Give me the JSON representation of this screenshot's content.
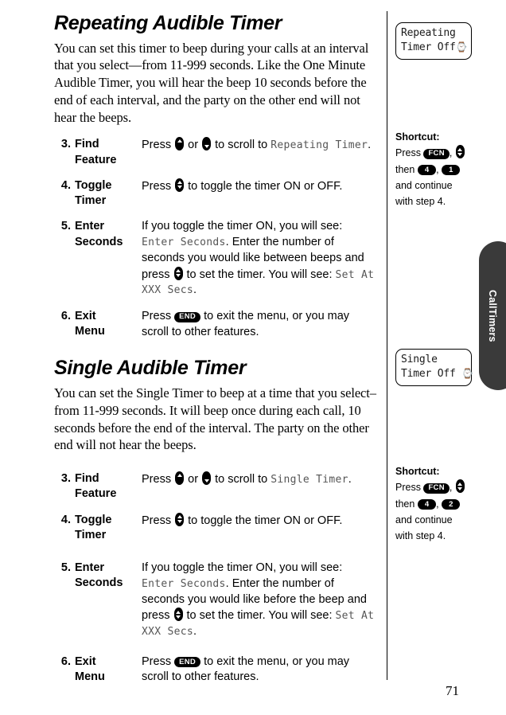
{
  "page": {
    "number": "71",
    "thumb_tab_label": "CallTimers",
    "tab_color": "#3a3a3a"
  },
  "sections": [
    {
      "title": "Repeating Audible Timer",
      "intro": "You can set this timer to beep during your calls at an interval that you select—from 11-999 seconds. Like the One Minute Audible Timer, you will hear the beep 10 seconds before the end of each interval, and the party on the other end will not hear the beeps.",
      "lcd": {
        "line1": "Repeating",
        "line2": "Timer Off",
        "clock_icon": "⌚"
      },
      "shortcut": {
        "heading": "Shortcut:",
        "press_label": "Press",
        "fcn_key": "FCN",
        "then_label": "then",
        "key1": "4",
        "key2": "1",
        "tail1": "and continue",
        "tail2": "with step 4."
      },
      "steps": [
        {
          "num": "3.",
          "label_line1": "Find",
          "label_line2": "Feature",
          "body_pre": "Press",
          "body_mid": "or",
          "body_post": "to scroll to",
          "lcd_text": "Repeating Timer",
          "body_end": "."
        },
        {
          "num": "4.",
          "label_line1": "Toggle",
          "label_line2": "Timer",
          "body_pre": "Press",
          "body_post": "to toggle the timer ON or OFF."
        },
        {
          "num": "5.",
          "label_line1": "Enter",
          "label_line2": "Seconds",
          "body_a": "If you toggle the timer ON, you will see:",
          "lcd_a": "Enter Seconds",
          "body_b": ". Enter the number of seconds you would like between beeps and press",
          "body_c": "to set the timer. You will see:",
          "lcd_b": "Set At XXX Secs",
          "body_d": "."
        },
        {
          "num": "6.",
          "label_line1": "Exit",
          "label_line2": "Menu",
          "body_pre": "Press",
          "end_key": "END",
          "body_post": "to exit the menu, or you may scroll to other features."
        }
      ]
    },
    {
      "title": "Single Audible Timer",
      "intro": "You can set the Single Timer to beep at a time that you select–from 11-999 seconds. It will beep once during each call, 10 seconds before the end of the interval. The party on the other end will not hear the beeps.",
      "lcd": {
        "line1": "Single",
        "line2": "Timer Off",
        "clock_icon": "⌚"
      },
      "shortcut": {
        "heading": "Shortcut:",
        "press_label": "Press",
        "fcn_key": "FCN",
        "then_label": "then",
        "key1": "4",
        "key2": "2",
        "tail1": "and continue",
        "tail2": "with step 4."
      },
      "steps": [
        {
          "num": "3.",
          "label_line1": "Find",
          "label_line2": "Feature",
          "body_pre": "Press",
          "body_mid": "or",
          "body_post": "to scroll to",
          "lcd_text": "Single Timer",
          "body_end": "."
        },
        {
          "num": "4.",
          "label_line1": "Toggle",
          "label_line2": "Timer",
          "body_pre": "Press",
          "body_post": "to toggle the timer ON or OFF."
        },
        {
          "num": "5.",
          "label_line1": "Enter",
          "label_line2": "Seconds",
          "body_a": "If you toggle the timer ON, you will see:",
          "lcd_a": "Enter Seconds",
          "body_b": ". Enter the number of seconds you would like before the beep and press",
          "body_c": "to set the timer. You will see:",
          "lcd_b": "Set At XXX Secs",
          "body_d": "."
        },
        {
          "num": "6.",
          "label_line1": "Exit",
          "label_line2": "Menu",
          "body_pre": "Press",
          "end_key": "END",
          "body_post": "to exit the menu, or you may scroll to other features."
        }
      ]
    }
  ]
}
